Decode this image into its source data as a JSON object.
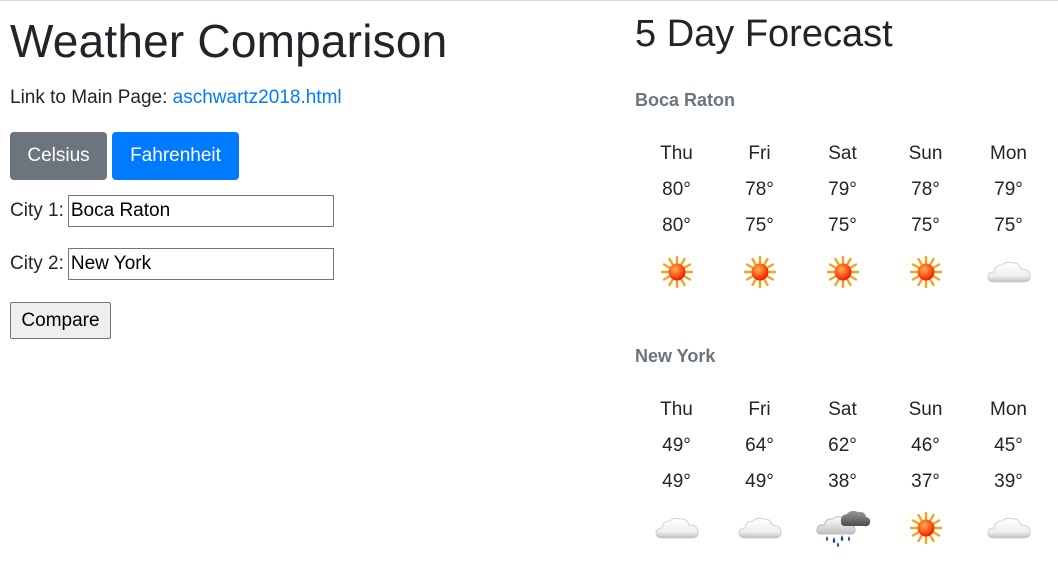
{
  "page": {
    "title": "Weather Comparison",
    "link_prefix": "Link to Main Page:",
    "link_text": "aschwartz2018.html"
  },
  "units": {
    "celsius_label": "Celsius",
    "fahrenheit_label": "Fahrenheit"
  },
  "form": {
    "city1_label": "City 1:",
    "city1_value": "Boca Raton",
    "city2_label": "City 2:",
    "city2_value": "New York",
    "compare_label": "Compare"
  },
  "forecast": {
    "title": "5 Day Forecast",
    "cities": [
      {
        "name": "Boca Raton",
        "days": [
          "Thu",
          "Fri",
          "Sat",
          "Sun",
          "Mon"
        ],
        "highs": [
          "80°",
          "78°",
          "79°",
          "78°",
          "79°"
        ],
        "lows": [
          "80°",
          "75°",
          "75°",
          "75°",
          "75°"
        ],
        "icons": [
          "sun-icon",
          "sun-icon",
          "sun-icon",
          "sun-icon",
          "cloud-icon"
        ]
      },
      {
        "name": "New York",
        "days": [
          "Thu",
          "Fri",
          "Sat",
          "Sun",
          "Mon"
        ],
        "highs": [
          "49°",
          "64°",
          "62°",
          "46°",
          "45°"
        ],
        "lows": [
          "49°",
          "49°",
          "38°",
          "37°",
          "39°"
        ],
        "icons": [
          "cloud-icon",
          "cloud-icon",
          "rain-cloud-icon",
          "sun-icon",
          "cloud-icon"
        ]
      }
    ]
  },
  "colors": {
    "celsius_button": "#6c757d",
    "fahrenheit_button": "#007bff",
    "link": "#007bff",
    "city_name": "#6c757d"
  }
}
